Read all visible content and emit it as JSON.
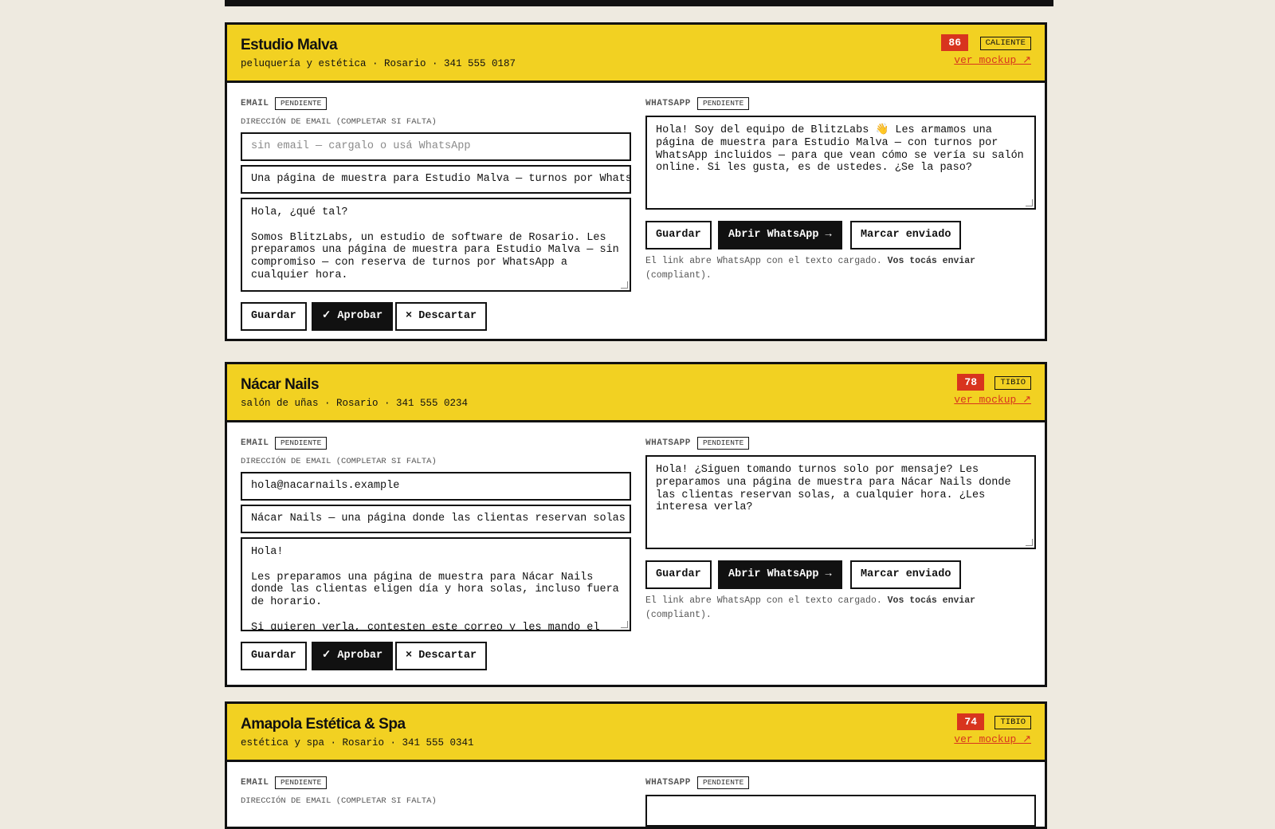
{
  "leads": [
    {
      "name": "Estudio Malva",
      "meta": "peluquería y estética · Rosario · 341 555 0187",
      "score": "86",
      "temperature": "CALIENTE",
      "mockup_link": "ver mockup ↗",
      "email": {
        "label": "EMAIL",
        "status": "PENDIENTE",
        "address_label": "DIRECCIÓN DE EMAIL (COMPLETAR SI FALTA)",
        "address_value": "",
        "address_placeholder": "sin email — cargalo o usá WhatsApp",
        "subject": "Una página de muestra para Estudio Malva — turnos por WhatsApp",
        "body": "Hola, ¿qué tal?\n\nSomos BlitzLabs, un estudio de software de Rosario. Les preparamos una página de muestra para Estudio Malva — sin compromiso — con reserva de turnos por WhatsApp a cualquier hora.",
        "buttons": {
          "save": "Guardar",
          "approve": "✓ Aprobar",
          "discard": "× Descartar"
        }
      },
      "whatsapp": {
        "label": "WHATSAPP",
        "status": "PENDIENTE",
        "message": "Hola! Soy del equipo de BlitzLabs 👋 Les armamos una página de muestra para Estudio Malva — con turnos por WhatsApp incluidos — para que vean cómo se vería su salón online. Si les gusta, es de ustedes. ¿Se la paso?",
        "buttons": {
          "save": "Guardar",
          "open": "Abrir WhatsApp →",
          "mark_sent": "Marcar enviado"
        },
        "note_prefix": "El link abre WhatsApp con el texto cargado.",
        "note_bold": "Vos tocás enviar",
        "note_suffix": "(compliant)."
      }
    },
    {
      "name": "Nácar Nails",
      "meta": "salón de uñas · Rosario · 341 555 0234",
      "score": "78",
      "temperature": "TIBIO",
      "mockup_link": "ver mockup ↗",
      "email": {
        "label": "EMAIL",
        "status": "PENDIENTE",
        "address_label": "DIRECCIÓN DE EMAIL (COMPLETAR SI FALTA)",
        "address_value": "hola@nacarnails.example",
        "address_placeholder": "",
        "subject": "Nácar Nails — una página donde las clientas reservan solas",
        "body": "Hola!\n\nLes preparamos una página de muestra para Nácar Nails donde las clientas eligen día y hora solas, incluso fuera de horario.\n\nSi quieren verla, contesten este correo y les mando el link.",
        "buttons": {
          "save": "Guardar",
          "approve": "✓ Aprobar",
          "discard": "× Descartar"
        }
      },
      "whatsapp": {
        "label": "WHATSAPP",
        "status": "PENDIENTE",
        "message": "Hola! ¿Siguen tomando turnos solo por mensaje? Les preparamos una página de muestra para Nácar Nails donde las clientas reservan solas, a cualquier hora. ¿Les interesa verla?",
        "buttons": {
          "save": "Guardar",
          "open": "Abrir WhatsApp →",
          "mark_sent": "Marcar enviado"
        },
        "note_prefix": "El link abre WhatsApp con el texto cargado.",
        "note_bold": "Vos tocás enviar",
        "note_suffix": "(compliant)."
      }
    },
    {
      "name": "Amapola Estética & Spa",
      "meta": "estética y spa · Rosario · 341 555 0341",
      "score": "74",
      "temperature": "TIBIO",
      "mockup_link": "ver mockup ↗",
      "email": {
        "label": "EMAIL",
        "status": "PENDIENTE",
        "address_label": "DIRECCIÓN DE EMAIL (COMPLETAR SI FALTA)"
      },
      "whatsapp": {
        "label": "WHATSAPP",
        "status": "PENDIENTE"
      }
    }
  ]
}
